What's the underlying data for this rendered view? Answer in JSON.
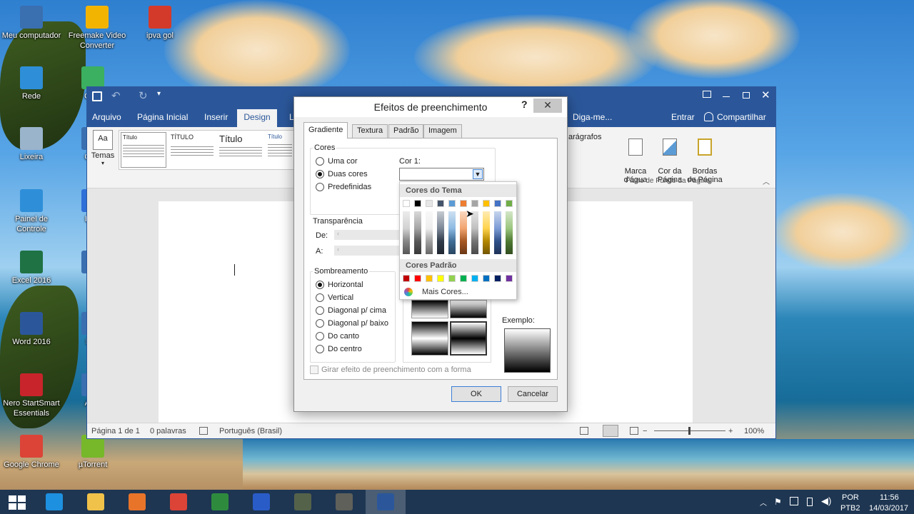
{
  "desktop": {
    "icons": [
      {
        "label": "Meu computador",
        "name": "desktop-icon-my-computer",
        "color": "#3a6fb0"
      },
      {
        "label": "Freemake Video\nConverter",
        "name": "desktop-icon-freemake",
        "color": "#f2b400"
      },
      {
        "label": "ipva gol",
        "name": "desktop-icon-ipva-pdf",
        "color": "#d43a2a"
      },
      {
        "label": "Rede",
        "name": "desktop-icon-network",
        "color": "#2e8fd8"
      },
      {
        "label": "Core",
        "name": "desktop-icon-core",
        "color": "#3bb060"
      },
      {
        "label": "Lixeira",
        "name": "desktop-icon-recycle-bin",
        "color": "#9ab4cc"
      },
      {
        "label": "Cam",
        "name": "desktop-icon-cam",
        "color": "#3a6fb0"
      },
      {
        "label": "Painel de\nControle",
        "name": "desktop-icon-control-panel",
        "color": "#2e8fd8"
      },
      {
        "label": "Baid",
        "name": "desktop-icon-baidu",
        "color": "#2e6fd8"
      },
      {
        "label": "Excel 2016",
        "name": "desktop-icon-excel",
        "color": "#1f7244"
      },
      {
        "label": "D\nCo",
        "name": "desktop-icon-d-co",
        "color": "#3a6fb0"
      },
      {
        "label": "Word 2016",
        "name": "desktop-icon-word",
        "color": "#2b579a"
      },
      {
        "label": "Forr",
        "name": "desktop-icon-forr",
        "color": "#3a6fb0"
      },
      {
        "label": "Nero StartSmart\nEssentials",
        "name": "desktop-icon-nero",
        "color": "#c8242b"
      },
      {
        "label": "Auto",
        "name": "desktop-icon-auto",
        "color": "#3a6fb0"
      },
      {
        "label": "Google Chrome",
        "name": "desktop-icon-chrome",
        "color": "#db4437"
      },
      {
        "label": "µTorrent",
        "name": "desktop-icon-utorrent",
        "color": "#76b82a"
      }
    ]
  },
  "word": {
    "tabs": {
      "arquivo": "Arquivo",
      "inicial": "Página Inicial",
      "inserir": "Inserir",
      "design": "Design",
      "layout": "L",
      "tell_me": "Diga-me...",
      "signin": "Entrar",
      "share": "Compartilhar"
    },
    "ribbon": {
      "temas": "Temas",
      "style1_title": "Título",
      "style2_title": "TÍTULO",
      "style3_title": "Título",
      "style4_title": "Título",
      "paragrafos": "arágrafos",
      "marca": "Marca\nd'água",
      "cor": "Cor da\nPágina",
      "bordas": "Bordas\nde Página",
      "group_label": "Plano de Fundo da Página"
    },
    "status": {
      "page": "Página 1 de 1",
      "words": "0 palavras",
      "language": "Português (Brasil)",
      "zoom": "100%",
      "zoom_minus": "−",
      "zoom_plus": "+"
    }
  },
  "dialog": {
    "title": "Efeitos de preenchimento",
    "help": "?",
    "close": "✕",
    "tabs": [
      "Gradiente",
      "Textura",
      "Padrão",
      "Imagem"
    ],
    "cores_label": "Cores",
    "color_options": [
      "Uma cor",
      "Duas cores",
      "Predefinidas"
    ],
    "cor1_label": "Cor 1:",
    "transparencia_label": "Transparência",
    "de_label": "De:",
    "a_label": "A:",
    "sombreamento_label": "Sombreamento",
    "shading_options": [
      "Horizontal",
      "Vertical",
      "Diagonal p/ cima",
      "Diagonal p/ baixo",
      "Do canto",
      "Do centro"
    ],
    "exemplo_label": "Exemplo:",
    "rotate_label": "Girar efeito de preenchimento com a forma",
    "ok": "OK",
    "cancel": "Cancelar"
  },
  "color_dropdown": {
    "theme_header": "Cores do Tema",
    "standard_header": "Cores Padrão",
    "more_colors": "Mais Cores...",
    "theme_colors": [
      "#ffffff",
      "#000000",
      "#e7e6e6",
      "#44546a",
      "#5b9bd5",
      "#ed7d31",
      "#a5a5a5",
      "#ffc000",
      "#4472c4",
      "#70ad47"
    ],
    "standard_colors": [
      "#c00000",
      "#ff0000",
      "#ffc000",
      "#ffff00",
      "#92d050",
      "#00b050",
      "#00b0f0",
      "#0070c0",
      "#002060",
      "#7030a0"
    ]
  },
  "taskbar": {
    "lang": "POR",
    "layout": "PTB2",
    "time": "11:56",
    "date": "14/03/2017",
    "apps": [
      {
        "name": "taskbar-ie",
        "color": "#1e90e0"
      },
      {
        "name": "taskbar-explorer",
        "color": "#f0c24a"
      },
      {
        "name": "taskbar-media-player",
        "color": "#e8742a"
      },
      {
        "name": "taskbar-chrome",
        "color": "#db4437"
      },
      {
        "name": "taskbar-calculator",
        "color": "#2e8b3e"
      },
      {
        "name": "taskbar-security",
        "color": "#2a5cc8"
      },
      {
        "name": "taskbar-app1",
        "color": "#55624a"
      },
      {
        "name": "taskbar-app2",
        "color": "#60605a"
      },
      {
        "name": "taskbar-word",
        "color": "#2b579a"
      }
    ]
  }
}
